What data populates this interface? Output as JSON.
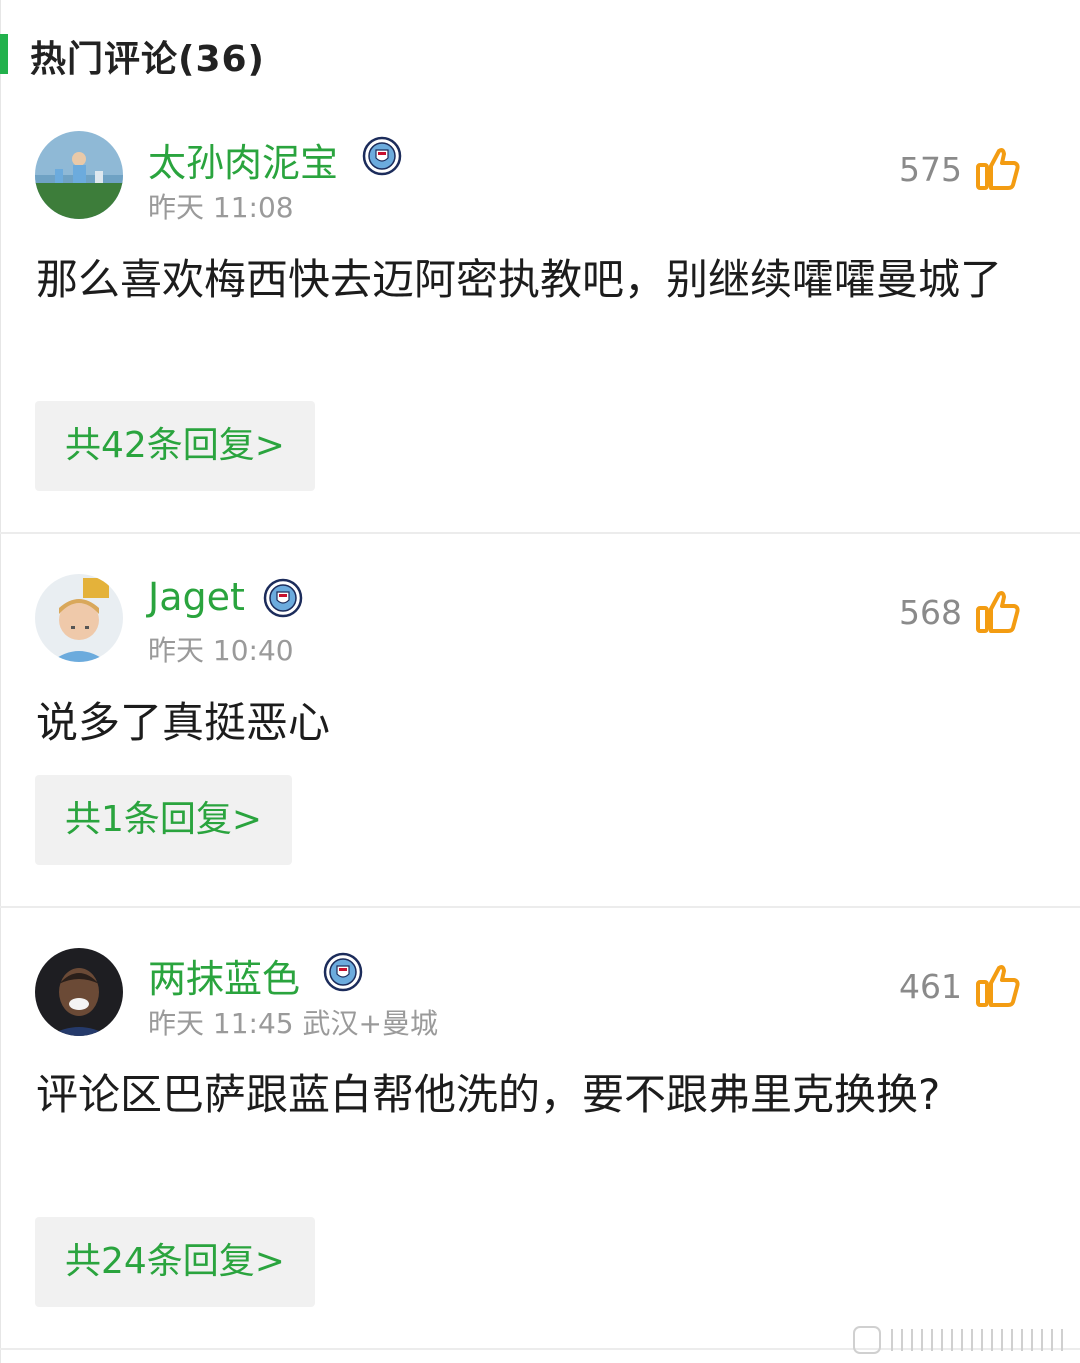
{
  "header": {
    "title": "热门评论(36)"
  },
  "colors": {
    "accent": "#22b14c",
    "link": "#2aa43e",
    "like": "#f39c12",
    "meta": "#9a9a9a"
  },
  "comments": [
    {
      "username": "太孙肉泥宝",
      "badge_icon": "man-city-crest-icon",
      "meta": "昨天 11:08",
      "likes": "575",
      "text": "那么喜欢梅西快去迈阿密执教吧，别继续嚯嚯曼城了",
      "replies": "共42条回复>"
    },
    {
      "username": "Jaget",
      "badge_icon": "man-city-crest-icon",
      "meta": "昨天 10:40",
      "likes": "568",
      "text": "说多了真挺恶心",
      "replies": "共1条回复>"
    },
    {
      "username": "两抹蓝色",
      "badge_icon": "man-city-crest-icon",
      "meta": "昨天 11:45 武汉+曼城",
      "likes": "461",
      "text": "评论区巴萨跟蓝白帮他洗的，要不跟弗里克换换?",
      "replies": "共24条回复>"
    }
  ]
}
